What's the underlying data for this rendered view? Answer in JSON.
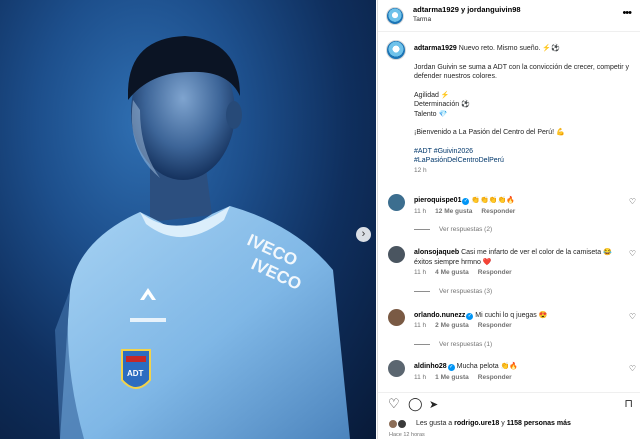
{
  "header": {
    "usernames": "adtarma1929 y jordanguivin98",
    "location": "Tarma",
    "more_icon": "more-horizontal-icon"
  },
  "caption": {
    "username": "adtarma1929",
    "headline": "Nuevo reto. Mismo sueño. ⚡⚽",
    "paragraph": "Jordan Guivin se suma a ADT con la convicción de crecer, competir y defender nuestros colores.",
    "traits": [
      "Agilidad ⚡",
      "Determinación ⚽",
      "Talento 💎"
    ],
    "welcome": "¡Bienvenido a La Pasión del Centro del Perú! 💪",
    "hashtags": [
      "#ADT #Guivin2026",
      "#LaPasiónDelCentroDelPerú"
    ],
    "time": "12 h"
  },
  "comments": [
    {
      "username": "pieroquispe01",
      "verified": true,
      "text": "👏👏👏👏🔥",
      "time": "11 h",
      "likes": "12 Me gusta",
      "reply": "Responder",
      "view_replies": "Ver respuestas (2)",
      "avatar_color": "#3c6e8f"
    },
    {
      "username": "alonsojaqueb",
      "verified": false,
      "text": "Casi me infarto de ver el color de la camiseta 😂 éxitos siempre hrmno ❤️",
      "time": "11 h",
      "likes": "4 Me gusta",
      "reply": "Responder",
      "view_replies": "Ver respuestas (3)",
      "avatar_color": "#4a5560"
    },
    {
      "username": "orlando.nunezz",
      "verified": true,
      "text": "Mi cuchi lo q juegas 😍",
      "time": "11 h",
      "likes": "2 Me gusta",
      "reply": "Responder",
      "view_replies": "Ver respuestas (1)",
      "avatar_color": "#7a5a44"
    },
    {
      "username": "aldinho28",
      "verified": true,
      "text": "Mucha pelota 👏🔥",
      "time": "11 h",
      "likes": "1 Me gusta",
      "reply": "Responder",
      "view_replies": "",
      "avatar_color": "#5b6670"
    }
  ],
  "actions": {
    "like_icon": "heart-icon",
    "comment_icon": "comment-icon",
    "share_icon": "send-icon",
    "save_icon": "bookmark-icon",
    "liked_by_prefix": "Les gusta a",
    "liked_by_user": "rodrigo.ure18",
    "liked_by_suffix": "y",
    "others": "1158 personas más",
    "posted": "Hace 12 horas"
  },
  "photo": {
    "jersey_brand": "IVECO",
    "crest_text": "ADT",
    "sleeve_text": "ADT",
    "next_icon": "chevron-right-icon"
  }
}
